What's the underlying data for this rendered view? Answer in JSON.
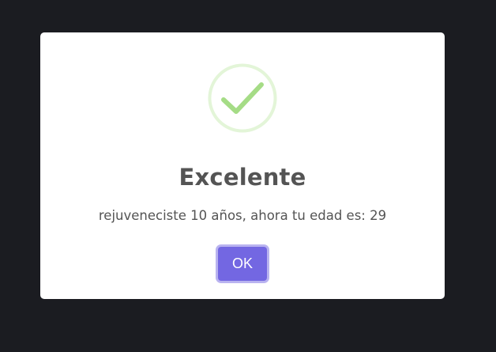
{
  "dialog": {
    "icon": "success-check-icon",
    "title": "Excelente",
    "message": "rejuveneciste 10 años, ahora tu edad es: 29",
    "ok_label": "OK"
  },
  "colors": {
    "backdrop": "#1b1c21",
    "dialog_bg": "#ffffff",
    "success_ring": "#e3f5d8",
    "success_check": "#a5dc86",
    "text": "#545454",
    "button": "#7367e2"
  }
}
